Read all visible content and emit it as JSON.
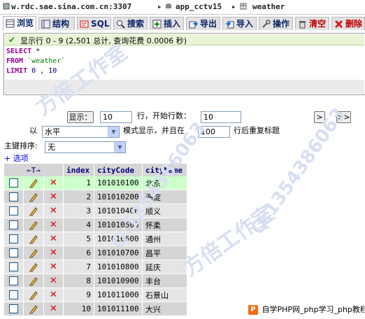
{
  "breadcrumb": {
    "server": "w.rdc.sae.sina.com.cn:3307",
    "database": "app_cctv15",
    "table": "weather",
    "sep": "▸"
  },
  "tabs": [
    {
      "label": "浏览",
      "icon": "browse-icon"
    },
    {
      "label": "结构",
      "icon": "structure-icon"
    },
    {
      "label": "SQL",
      "icon": "sql-icon"
    },
    {
      "label": "搜索",
      "icon": "search-icon"
    },
    {
      "label": "插入",
      "icon": "insert-icon"
    },
    {
      "label": "导出",
      "icon": "export-icon"
    },
    {
      "label": "导入",
      "icon": "import-icon"
    },
    {
      "label": "操作",
      "icon": "operations-icon"
    },
    {
      "label": "清空",
      "icon": "empty-icon"
    },
    {
      "label": "删除",
      "icon": "drop-icon"
    }
  ],
  "message": "显示行 0 - 9 (2,501 总计, 查询花费 0.0006 秒)",
  "sql": {
    "select": "SELECT",
    "star": "*",
    "from": "FROM",
    "table": "`weather`",
    "limit": "LIMIT",
    "offset": "0",
    "comma": ",",
    "count": "10"
  },
  "nav": {
    "show_button": "显示：",
    "rows_value": "10",
    "start_label": "行，开始行数：",
    "start_value": "10",
    "prev_button": ">",
    "next_button": ">>",
    "with_label": "以",
    "mode_value": "水平",
    "mode_label": "模式显示，并且在",
    "repeat_value": "100",
    "repeat_label": "行后重复标题"
  },
  "sort": {
    "label": "主键排序:",
    "value": "无"
  },
  "options_link": "+ 选项",
  "table": {
    "arrows": "←T→",
    "columns": [
      "index",
      "cityCode",
      "cityName"
    ],
    "rows": [
      {
        "index": "1",
        "code": "101010100",
        "name": "北京"
      },
      {
        "index": "2",
        "code": "101010200",
        "name": "海淀"
      },
      {
        "index": "3",
        "code": "101010400",
        "name": "顺义"
      },
      {
        "index": "4",
        "code": "101010500",
        "name": "怀柔"
      },
      {
        "index": "5",
        "code": "101010600",
        "name": "通州"
      },
      {
        "index": "6",
        "code": "101010700",
        "name": "昌平"
      },
      {
        "index": "7",
        "code": "101010800",
        "name": "延庆"
      },
      {
        "index": "8",
        "code": "101010900",
        "name": "丰台"
      },
      {
        "index": "9",
        "code": "101011000",
        "name": "石景山"
      },
      {
        "index": "10",
        "code": "101011100",
        "name": "大兴"
      }
    ]
  },
  "watermark": {
    "a": "方倍工作室",
    "b": "Q:1354386063"
  },
  "badge": "自学PHP网_php学习_php教程"
}
